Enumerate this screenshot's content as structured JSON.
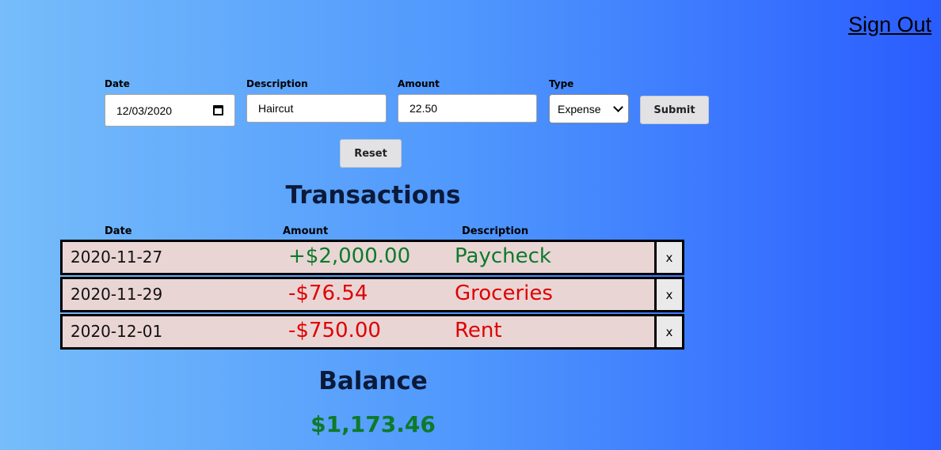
{
  "header": {
    "sign_out": "Sign Out"
  },
  "form": {
    "date_label": "Date",
    "date_value": "12/03/2020",
    "description_label": "Description",
    "description_value": "Haircut",
    "amount_label": "Amount",
    "amount_value": "22.50",
    "type_label": "Type",
    "type_value": "Expense",
    "submit": "Submit",
    "reset": "Reset"
  },
  "transactions": {
    "title": "Transactions",
    "columns": [
      "Date",
      "Amount",
      "Description"
    ],
    "rows": [
      {
        "date": "2020-11-27",
        "amount": "+$2,000.00",
        "description": "Paycheck",
        "delete": "x",
        "kind": "income"
      },
      {
        "date": "2020-11-29",
        "amount": "-$76.54",
        "description": "Groceries",
        "delete": "x",
        "kind": "expense"
      },
      {
        "date": "2020-12-01",
        "amount": "-$750.00",
        "description": "Rent",
        "delete": "x",
        "kind": "expense"
      }
    ]
  },
  "balance": {
    "title": "Balance",
    "value": "$1,173.46"
  },
  "colors": {
    "income": "#0d7a2a",
    "expense": "#e00000",
    "row_bg": "#ead5d5"
  }
}
